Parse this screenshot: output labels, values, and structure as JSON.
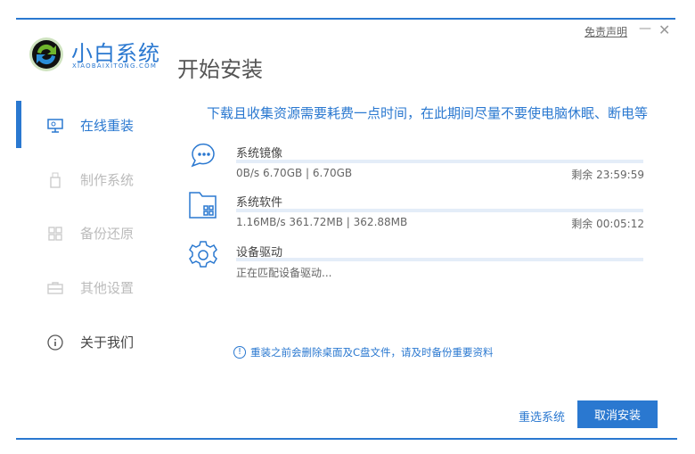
{
  "header": {
    "brand": "小白系统",
    "brand_sub": "XIAOBAIXITONG.COM",
    "title": "开始安装",
    "disclaimer": "免责声明",
    "minimize": "—",
    "close": "✕"
  },
  "sidebar": {
    "items": [
      {
        "label": "在线重装",
        "icon": "monitor-icon",
        "active": true
      },
      {
        "label": "制作系统",
        "icon": "usb-icon",
        "active": false
      },
      {
        "label": "备份还原",
        "icon": "grid-icon",
        "active": false
      },
      {
        "label": "其他设置",
        "icon": "briefcase-icon",
        "active": false
      },
      {
        "label": "关于我们",
        "icon": "info-icon",
        "active": false
      }
    ]
  },
  "main": {
    "notice": "下载且收集资源需要耗费一点时间，在此期间尽量不要使电脑休眠、断电等",
    "items": [
      {
        "label": "系统镜像",
        "icon": "chat-bubble-icon",
        "stats": "0B/s 6.70GB | 6.70GB",
        "remaining": "剩余 23:59:59",
        "progress": 0
      },
      {
        "label": "系统软件",
        "icon": "folder-icon",
        "stats": "1.16MB/s 361.72MB | 362.88MB",
        "remaining": "剩余 00:05:12",
        "progress": 0
      },
      {
        "label": "设备驱动",
        "icon": "gear-icon",
        "stats": "正在匹配设备驱动...",
        "progress": 0
      }
    ],
    "warning": "重装之前会删除桌面及C盘文件，请及时备份重要资料",
    "warning_icon": "!"
  },
  "footer": {
    "reselect": "重选系统",
    "cancel": "取消安装"
  },
  "colors": {
    "accent": "#2a78d0"
  }
}
